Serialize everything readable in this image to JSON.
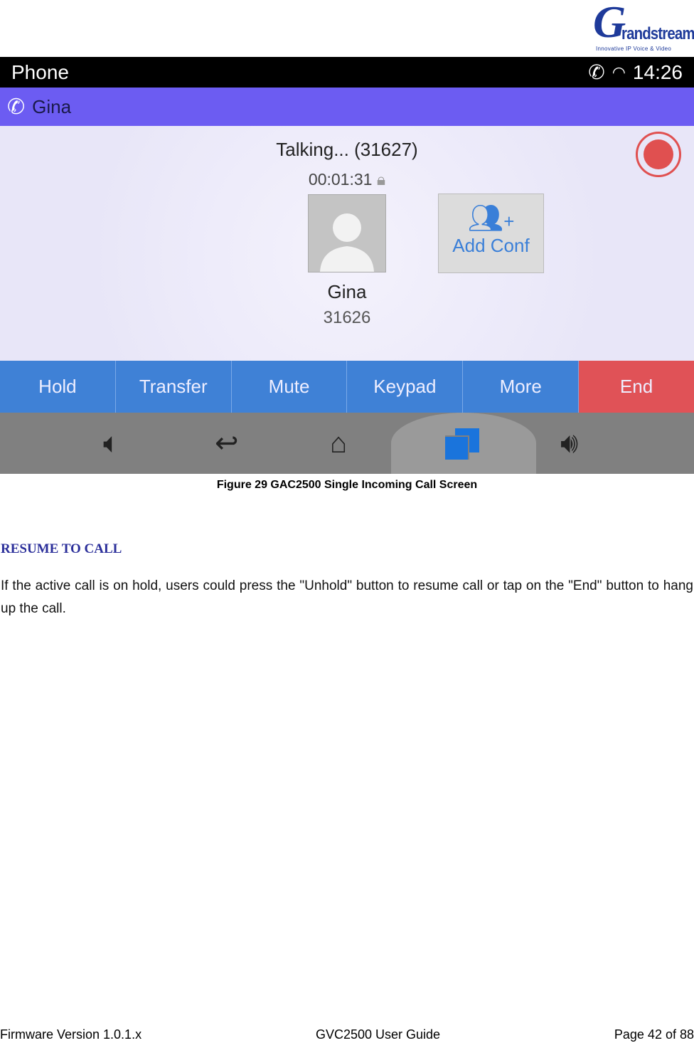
{
  "logo": {
    "brand": "Grandstream",
    "tagline": "Innovative IP Voice & Video"
  },
  "screenshot": {
    "status_bar": {
      "title": "Phone",
      "time": "14:26",
      "icons": [
        "call-icon",
        "wifi-icon"
      ]
    },
    "header": {
      "contact": "Gina",
      "icon": "call-message-icon"
    },
    "call": {
      "status": "Talking... (31627)",
      "duration": "00:01:31",
      "name": "Gina",
      "number": "31626",
      "add_conf_label": "Add Conf",
      "record_color": "#e05050"
    },
    "buttons": [
      "Hold",
      "Transfer",
      "Mute",
      "Keypad",
      "More",
      "End"
    ],
    "nav_icons": [
      "volume-down-icon",
      "back-icon",
      "home-icon",
      "recent-apps-icon",
      "volume-up-icon"
    ]
  },
  "caption": "Figure 29 GAC2500 Single Incoming Call Screen",
  "section": {
    "heading": "RESUME TO CALL",
    "body": "If the active call is on hold, users could press the \"Unhold\" button to resume call or tap on the \"End\" button to hang up the call."
  },
  "footer": {
    "left": "Firmware Version 1.0.1.x",
    "center": "GVC2500 User Guide",
    "right": "Page 42 of 88"
  }
}
